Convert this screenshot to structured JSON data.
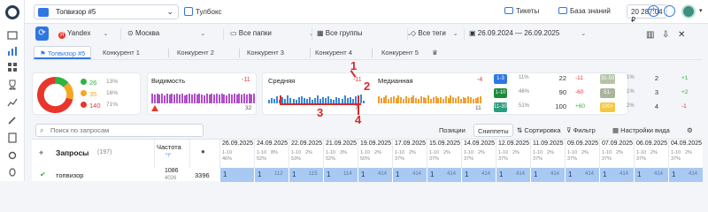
{
  "topbar": {
    "project": "Топвизор #5",
    "toolbox": "Тулбокс",
    "tickets": "Тикеты",
    "knowledge_base": "База знаний",
    "balance": "20 287.04 ₽"
  },
  "filters": {
    "engine": "Yandex",
    "region": "Москва",
    "folders": "Все папки",
    "groups": "Все группы",
    "tags": "Все теги",
    "date_range": "26.09.2024 — 26.09.2025"
  },
  "tabs": {
    "items": [
      "Топвизор #5",
      "Конкурент 1",
      "Конкурент 2",
      "Конкурент 3",
      "Конкурент 4",
      "Конкурент 5"
    ]
  },
  "summary": {
    "donut": [
      {
        "label": "26",
        "pct": "13%",
        "color": "#2fb344",
        "value": 13
      },
      {
        "label": "35",
        "pct": "16%",
        "color": "#f5a623",
        "value": 16
      },
      {
        "label": "140",
        "pct": "71%",
        "color": "#e8362c",
        "value": 71
      }
    ],
    "visibility": {
      "title": "Видимость",
      "delta": "-11",
      "value": "32",
      "baseline": "0"
    },
    "average": {
      "title": "Средняя",
      "delta": "-11",
      "value": "7"
    },
    "median": {
      "title": "Медианная",
      "delta": "-4",
      "value": "11"
    }
  },
  "ranks": {
    "rows": [
      {
        "range": "1-3",
        "pct": "11%",
        "count": "22",
        "delta": "-11",
        "color": "#2f77e2",
        "range2": "31-50",
        "pct2": "1%",
        "count2": "2",
        "delta2": "+1",
        "color2": "#b5c4a8"
      },
      {
        "range": "1-10",
        "pct": "46%",
        "count": "90",
        "delta": "-60",
        "color": "#1e8a3a",
        "range2": "51-100",
        "pct2": "1%",
        "count2": "3",
        "delta2": "+2",
        "color2": "#a9b49a"
      },
      {
        "range": "11-30",
        "pct": "51%",
        "count": "100",
        "delta": "+60",
        "color": "#2a9d7a",
        "range2": "100+",
        "pct2": "2%",
        "count2": "4",
        "delta2": "-1",
        "color2": "#f5c842"
      }
    ]
  },
  "annotations": [
    "1",
    "2",
    "3",
    "4"
  ],
  "grid": {
    "search_placeholder": "Поиск по запросам",
    "seg_positions": "Позиции",
    "seg_snippets": "Сниппеты",
    "sort": "Сортировка",
    "filter": "Фильтр",
    "view_settings": "Настройки вида",
    "col_queries": "Запросы",
    "queries_count": "(197)",
    "col_freq": "Частота",
    "freq_sub": "\"!\"",
    "dates": [
      "26.09.2025",
      "24.09.2025",
      "22.09.2025",
      "21.09.2025",
      "19.09.2025",
      "17.09.2025",
      "15.09.2025",
      "14.09.2025",
      "12.09.2025",
      "11.09.2025",
      "09.09.2025",
      "07.09.2025",
      "06.09.2025",
      "04.09.2025"
    ],
    "sub_top": [
      "1-10",
      "1-10",
      "1-10",
      "1-10",
      "1-10",
      "1-10",
      "1-10",
      "1-10",
      "1-10",
      "1-10",
      "1-10",
      "1-10",
      "1-10",
      "1-10"
    ],
    "sub_pct": [
      "46%",
      "52%",
      "53%",
      "52%",
      "50%",
      "37%",
      "37%",
      "37%",
      "37%",
      "37%",
      "37%",
      "37%",
      "37%",
      "37%"
    ],
    "sub_vis": [
      "",
      "8%",
      "2%",
      "3%",
      "2%",
      "2%",
      "2%",
      "2%",
      "2%",
      "2%",
      "2%",
      "2%",
      "2%",
      "2%"
    ],
    "row": {
      "query": "топвизор",
      "freq": "1086",
      "freq2": "4026",
      "col3": "3396",
      "positions": [
        "1",
        "1",
        "1",
        "1",
        "1",
        "1",
        "1",
        "1",
        "1",
        "1",
        "1",
        "1",
        "1",
        "1"
      ],
      "notes": [
        "",
        "112",
        "115",
        "114",
        "414",
        "414",
        "414",
        "414",
        "414",
        "414",
        "414",
        "414",
        "414",
        "414"
      ]
    }
  }
}
